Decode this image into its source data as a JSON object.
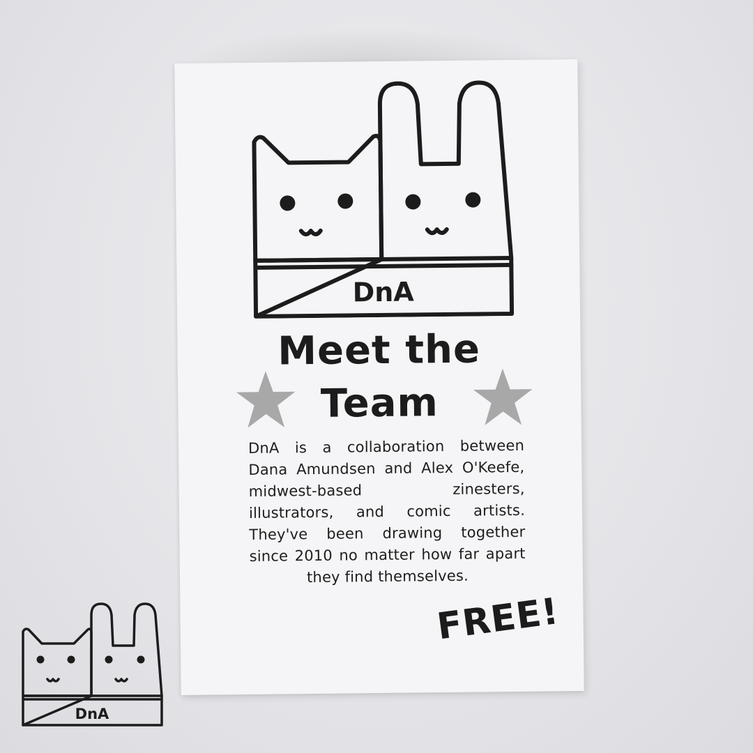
{
  "zine": {
    "logo_text": "DnA",
    "title_line1": "Meet the",
    "title_line2": "Team",
    "body": "DnA is a collaboration between Dana Amundsen and Alex O'Keefe, midwest-based zinesters, illustrators, and comic artists. They've been drawing together since 2010 no matter how far apart they find themselves.",
    "price_label": "FREE!"
  },
  "watermark": {
    "logo_text": "DnA"
  },
  "colors": {
    "background": "#e6e6ea",
    "paper": "#f5f5f7",
    "ink": "#1c1c1c",
    "star": "#a8a8a8"
  }
}
